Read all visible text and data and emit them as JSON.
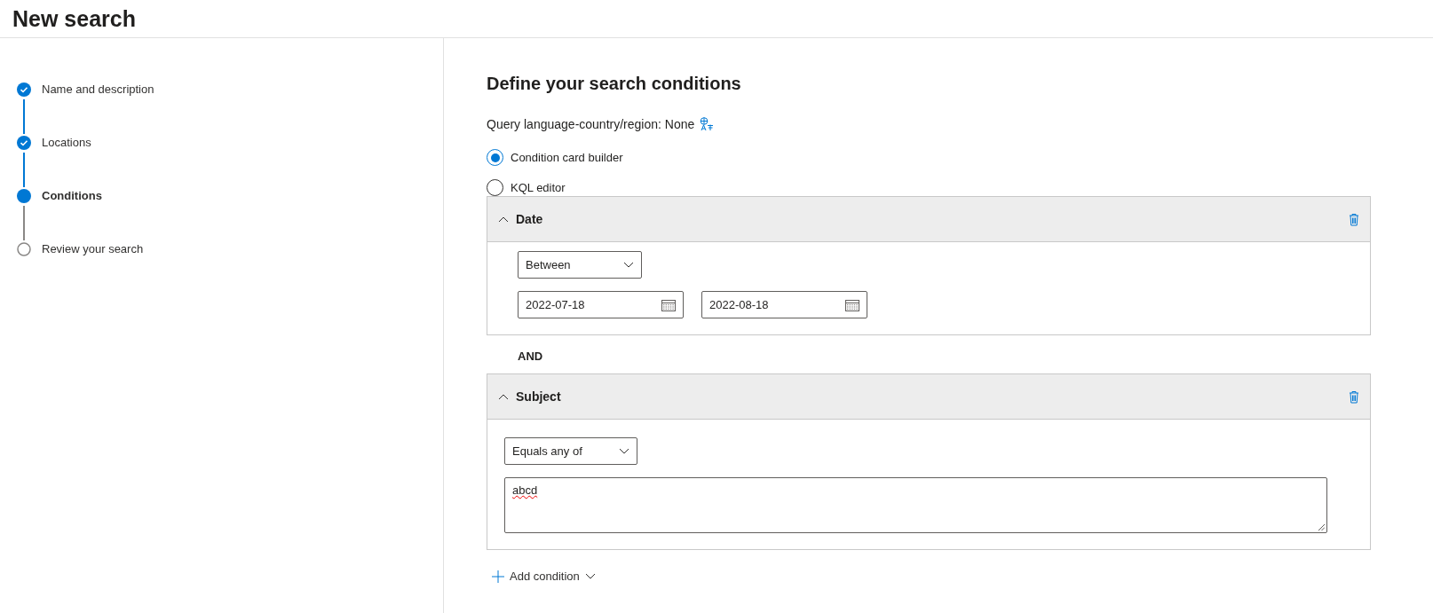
{
  "page_title": "New search",
  "steps": [
    {
      "label": "Name and description",
      "completed": true,
      "current": false
    },
    {
      "label": "Locations",
      "completed": true,
      "current": false
    },
    {
      "label": "Conditions",
      "completed": false,
      "current": true
    },
    {
      "label": "Review your search",
      "completed": false,
      "current": false
    }
  ],
  "heading": "Define your search conditions",
  "query_language": "Query language-country/region: None",
  "modes": [
    {
      "label": "Condition card builder",
      "selected": true
    },
    {
      "label": "KQL editor",
      "selected": false
    }
  ],
  "conditions": [
    {
      "kind": "date",
      "title": "Date",
      "expanded": true,
      "operator": "Between",
      "from": "2022-07-18",
      "to": "2022-08-18"
    },
    {
      "kind": "text",
      "title": "Subject",
      "expanded": true,
      "operator": "Equals any of",
      "value": "abcd"
    }
  ],
  "joiner": "AND",
  "add_condition": "Add condition"
}
